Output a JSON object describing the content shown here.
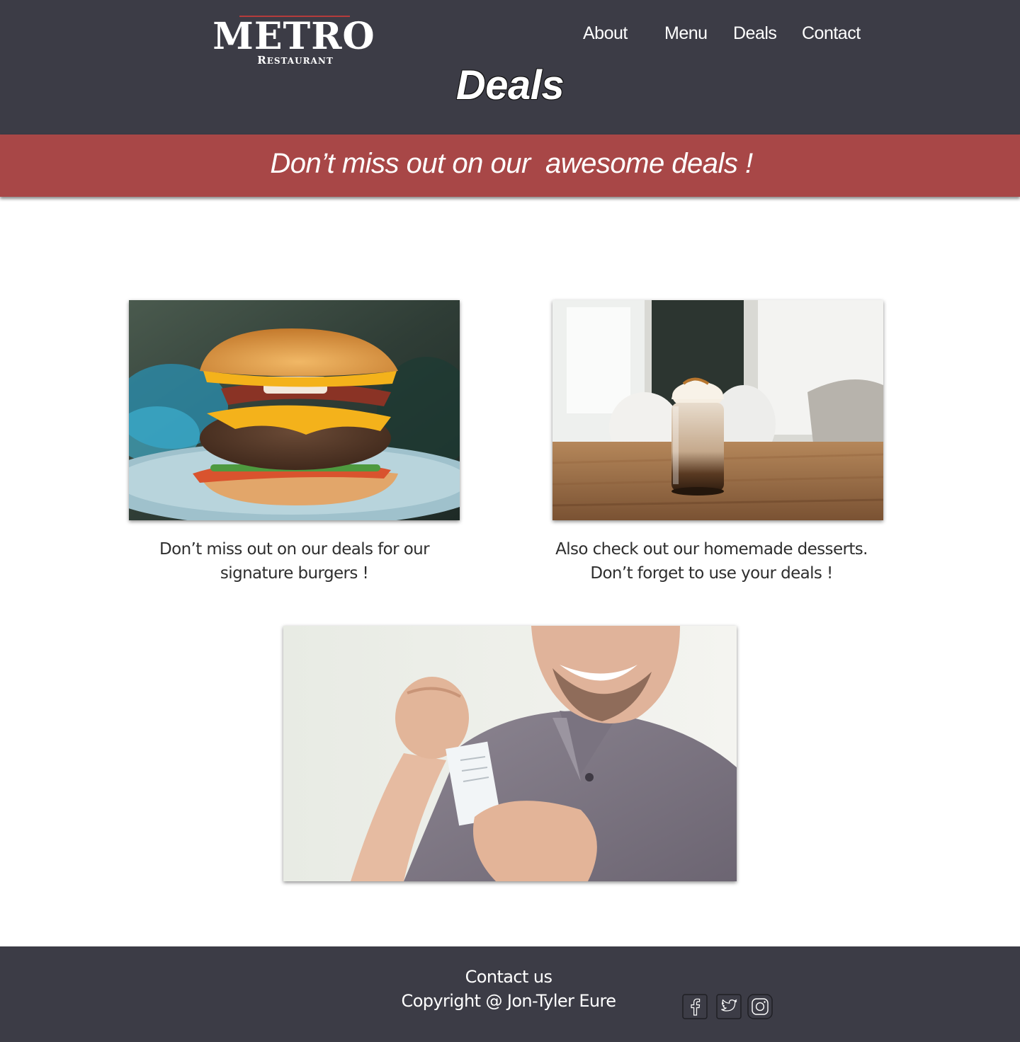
{
  "header": {
    "logo": {
      "word": "METRO",
      "sub": "Restaurant"
    },
    "nav": [
      {
        "label": "About"
      },
      {
        "label": "Menu"
      },
      {
        "label": "Deals"
      },
      {
        "label": "Contact"
      }
    ],
    "page_title": "Deals"
  },
  "banner": {
    "text": "Don’t miss out on our  awesome deals !"
  },
  "deals": [
    {
      "image": "burger-photo",
      "caption_lines": [
        "Don’t miss out on our deals for our",
        "signature burgers !"
      ]
    },
    {
      "image": "iced-coffee-dessert-photo",
      "caption_lines": [
        "Also check out our homemade desserts.",
        "Don’t forget to use your deals !"
      ]
    },
    {
      "image": "smiling-man-with-receipt-photo"
    }
  ],
  "footer": {
    "contact": "Contact us",
    "copyright": "Copyright @ Jon-Tyler Eure",
    "social_icons": [
      "facebook-icon",
      "twitter-icon",
      "instagram-icon"
    ]
  },
  "colors": {
    "header_bg": "#3c3c46",
    "banner_bg": "#a84747",
    "logo_accent": "#b53b3b",
    "text_dark": "#2e2e2e",
    "page_bg": "#ffffff"
  }
}
